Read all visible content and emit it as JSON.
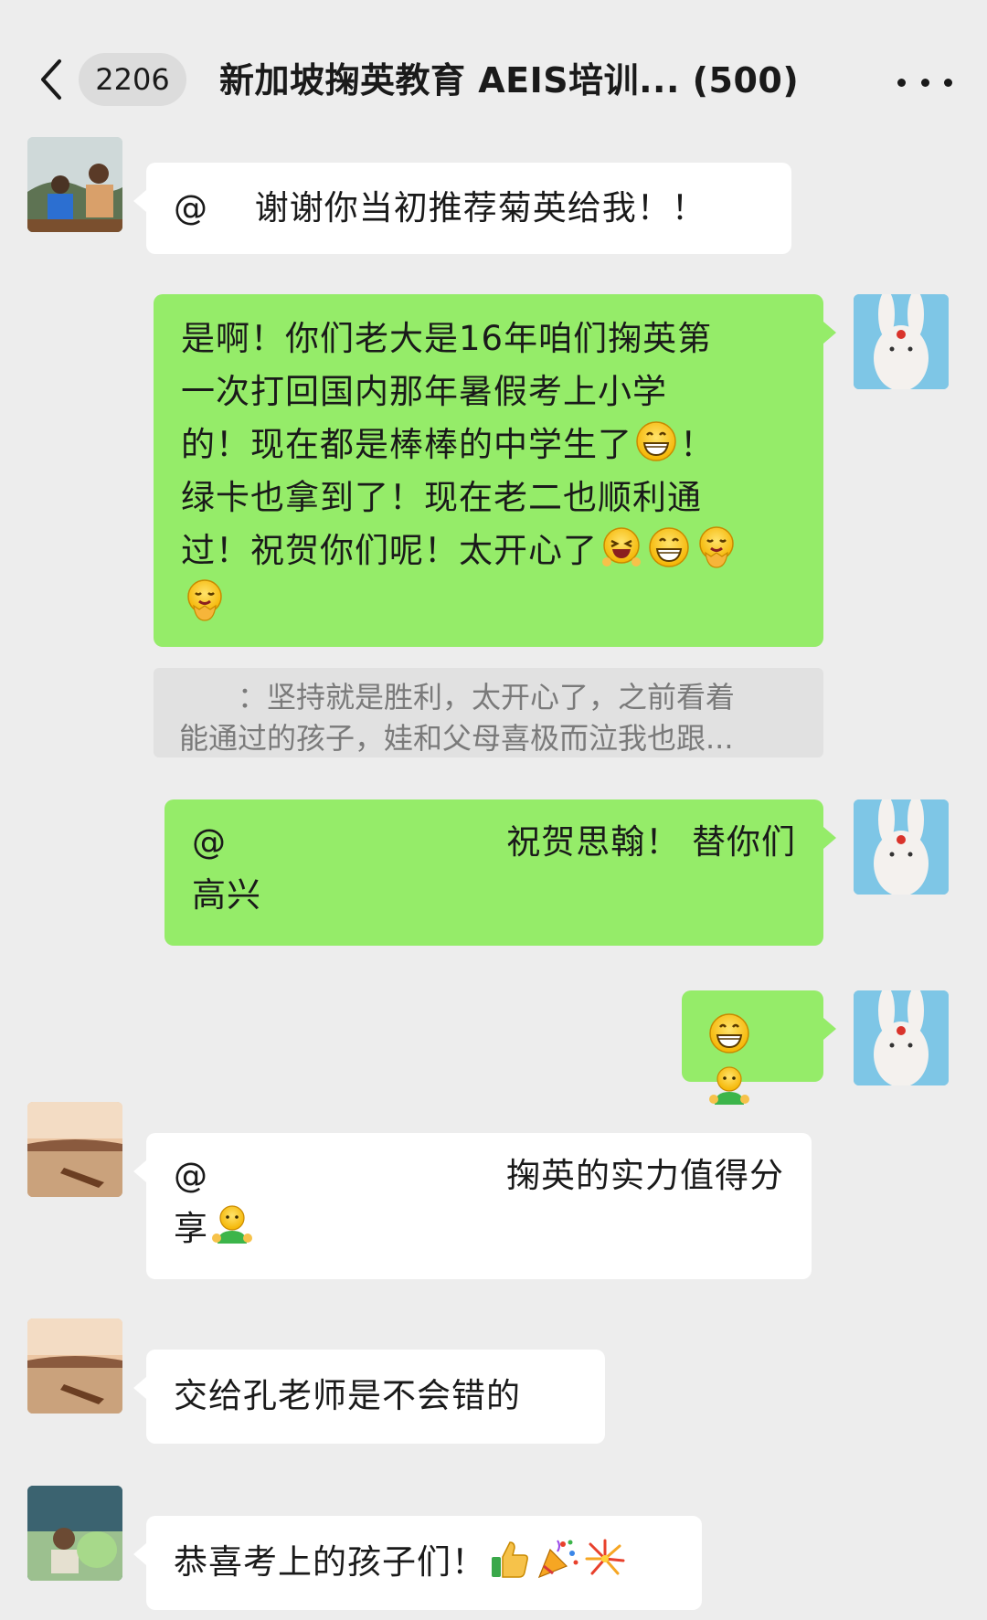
{
  "header": {
    "unread_count": "2206",
    "title": "新加坡掬英教育 AEIS培训... (500)"
  },
  "messages": [
    {
      "side": "left",
      "text": "@　 谢谢你当初推荐菊英给我！！"
    },
    {
      "side": "right",
      "text_lines": [
        "是啊！你们老大是16年咱们掬英第",
        "一次打回国内那年暑假考上小学",
        "的！现在都是棒棒的中学生了",
        "绿卡也拿到了！现在老二也顺利通",
        "过！祝贺你们呢！太开心了"
      ]
    },
    {
      "quote_lines": [
        "　　：坚持就是胜利，太开心了，之前看着",
        "能通过的孩子，娃和父母喜极而泣我也跟..."
      ]
    },
    {
      "side": "right",
      "line1_at": "@",
      "line1_text": "祝贺思翰！ 替你们",
      "line2": "高兴"
    },
    {
      "side": "right",
      "emoji_only": true
    },
    {
      "side": "left",
      "line1_at": "@",
      "line1_text": "掬英的实力值得分",
      "line2": "享"
    },
    {
      "side": "left",
      "text": "交给孔老师是不会错的"
    },
    {
      "side": "left",
      "text": "恭喜考上的孩子们！"
    }
  ],
  "icons": [
    "chevron-left-icon",
    "more-icon",
    "grin-emoji",
    "laugh-emoji",
    "hug-emoji",
    "buddy-emoji",
    "thumbs-up-emoji",
    "party-popper-emoji",
    "fireworks-emoji"
  ],
  "colors": {
    "background": "#ededed",
    "green_bubble": "#95ec69",
    "white_bubble": "#ffffff"
  }
}
